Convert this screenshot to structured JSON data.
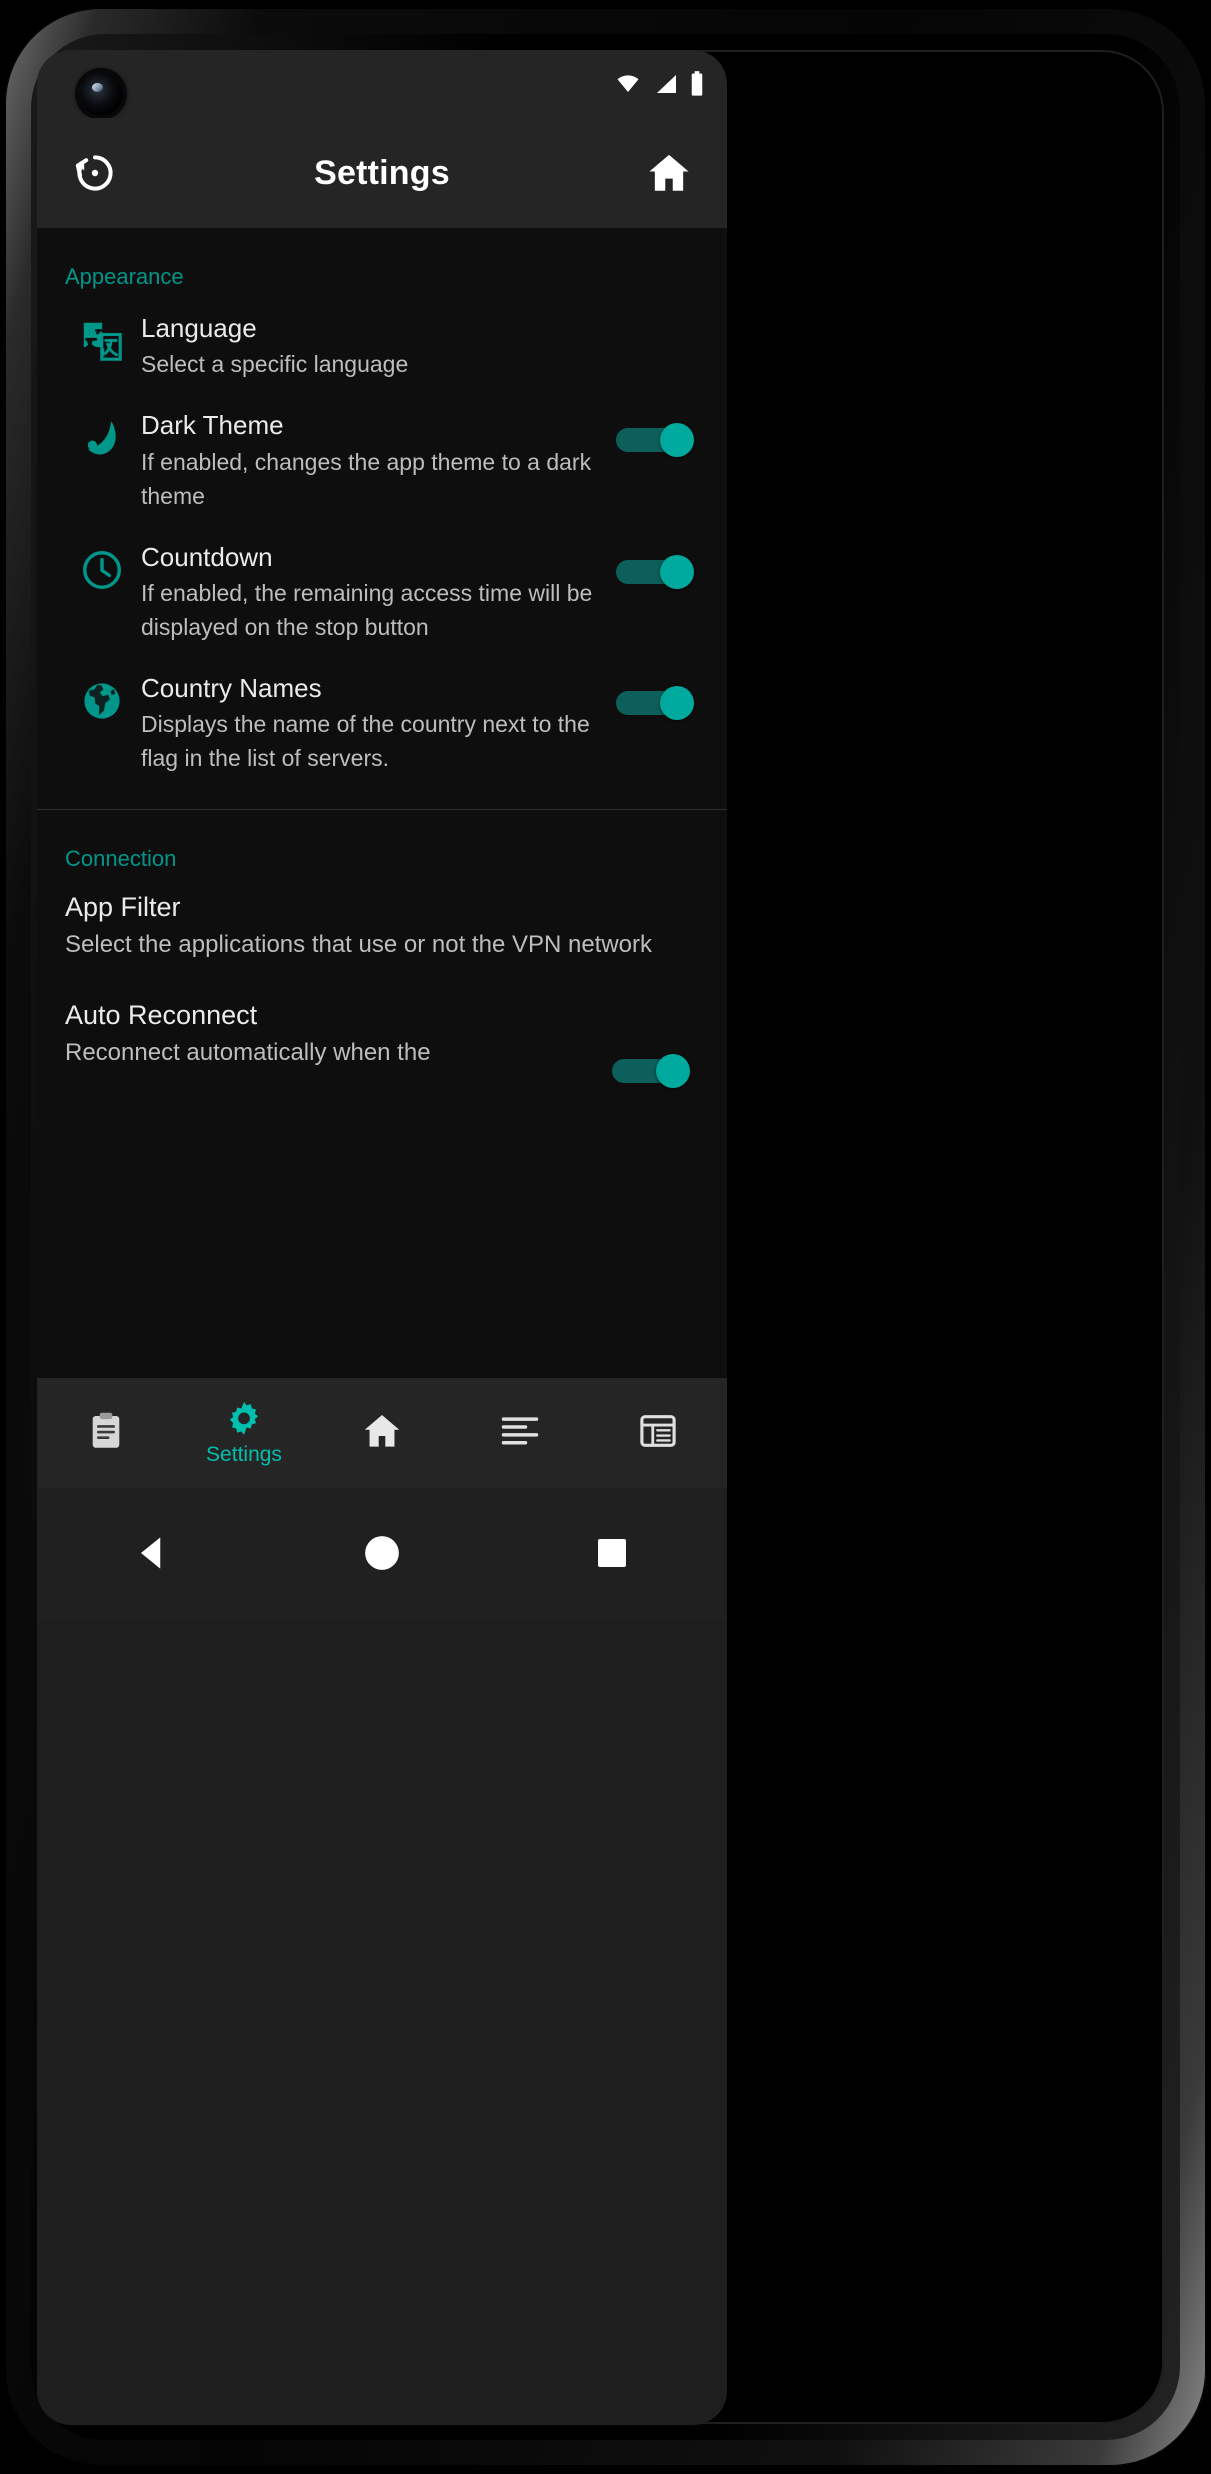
{
  "device": {
    "camera_icon": "front-camera-punch-hole"
  },
  "statusbar": {
    "icons": [
      "wifi-icon",
      "signal-icon",
      "battery-icon"
    ]
  },
  "appbar": {
    "title": "Settings",
    "left_icon": "restore-defaults-icon",
    "right_icon": "home-icon"
  },
  "sections": [
    {
      "id": "appearance",
      "label": "Appearance",
      "rows": [
        {
          "id": "language",
          "icon": "translate-icon",
          "title": "Language",
          "subtitle": "Select a specific language",
          "has_toggle": false
        },
        {
          "id": "dark-theme",
          "icon": "moon-icon",
          "title": "Dark Theme",
          "subtitle": "If enabled, changes the app theme to a dark theme",
          "has_toggle": true,
          "toggle_on": true
        },
        {
          "id": "countdown",
          "icon": "clock-icon",
          "title": "Countdown",
          "subtitle": "If enabled, the remaining access time will be displayed on the stop button",
          "has_toggle": true,
          "toggle_on": true
        },
        {
          "id": "country-names",
          "icon": "globe-icon",
          "title": "Country Names",
          "subtitle": "Displays the name of the country next to the flag in the list of servers.",
          "has_toggle": true,
          "toggle_on": true
        }
      ]
    },
    {
      "id": "connection",
      "label": "Connection",
      "rows": [
        {
          "id": "app-filter",
          "title": "App Filter",
          "subtitle": "Select the applications that use or not the VPN network",
          "has_toggle": false
        },
        {
          "id": "auto-reconnect",
          "title": "Auto Reconnect",
          "subtitle": "Reconnect automatically when the",
          "has_toggle": true,
          "toggle_on": true
        }
      ]
    }
  ],
  "bottomnav": {
    "items": [
      {
        "id": "logs",
        "icon": "clipboard-icon",
        "label": "",
        "active": false
      },
      {
        "id": "settings",
        "icon": "gear-icon",
        "label": "Settings",
        "active": true
      },
      {
        "id": "home",
        "icon": "home-icon",
        "label": "",
        "active": false
      },
      {
        "id": "list",
        "icon": "lines-icon",
        "label": "",
        "active": false
      },
      {
        "id": "servers",
        "icon": "table-icon",
        "label": "",
        "active": false
      }
    ]
  },
  "sysnav": {
    "back": "back-triangle-icon",
    "home": "home-circle-icon",
    "recents": "recents-square-icon"
  },
  "colors": {
    "accent": "#00968a",
    "accent_bright": "#00bfae",
    "toggle_knob": "#00a99d",
    "toggle_track": "#0c5f5a",
    "bg": "#0e0e0e",
    "bar": "#252525",
    "title_text": "#ebebeb",
    "sub_text": "#bdbdbd"
  }
}
